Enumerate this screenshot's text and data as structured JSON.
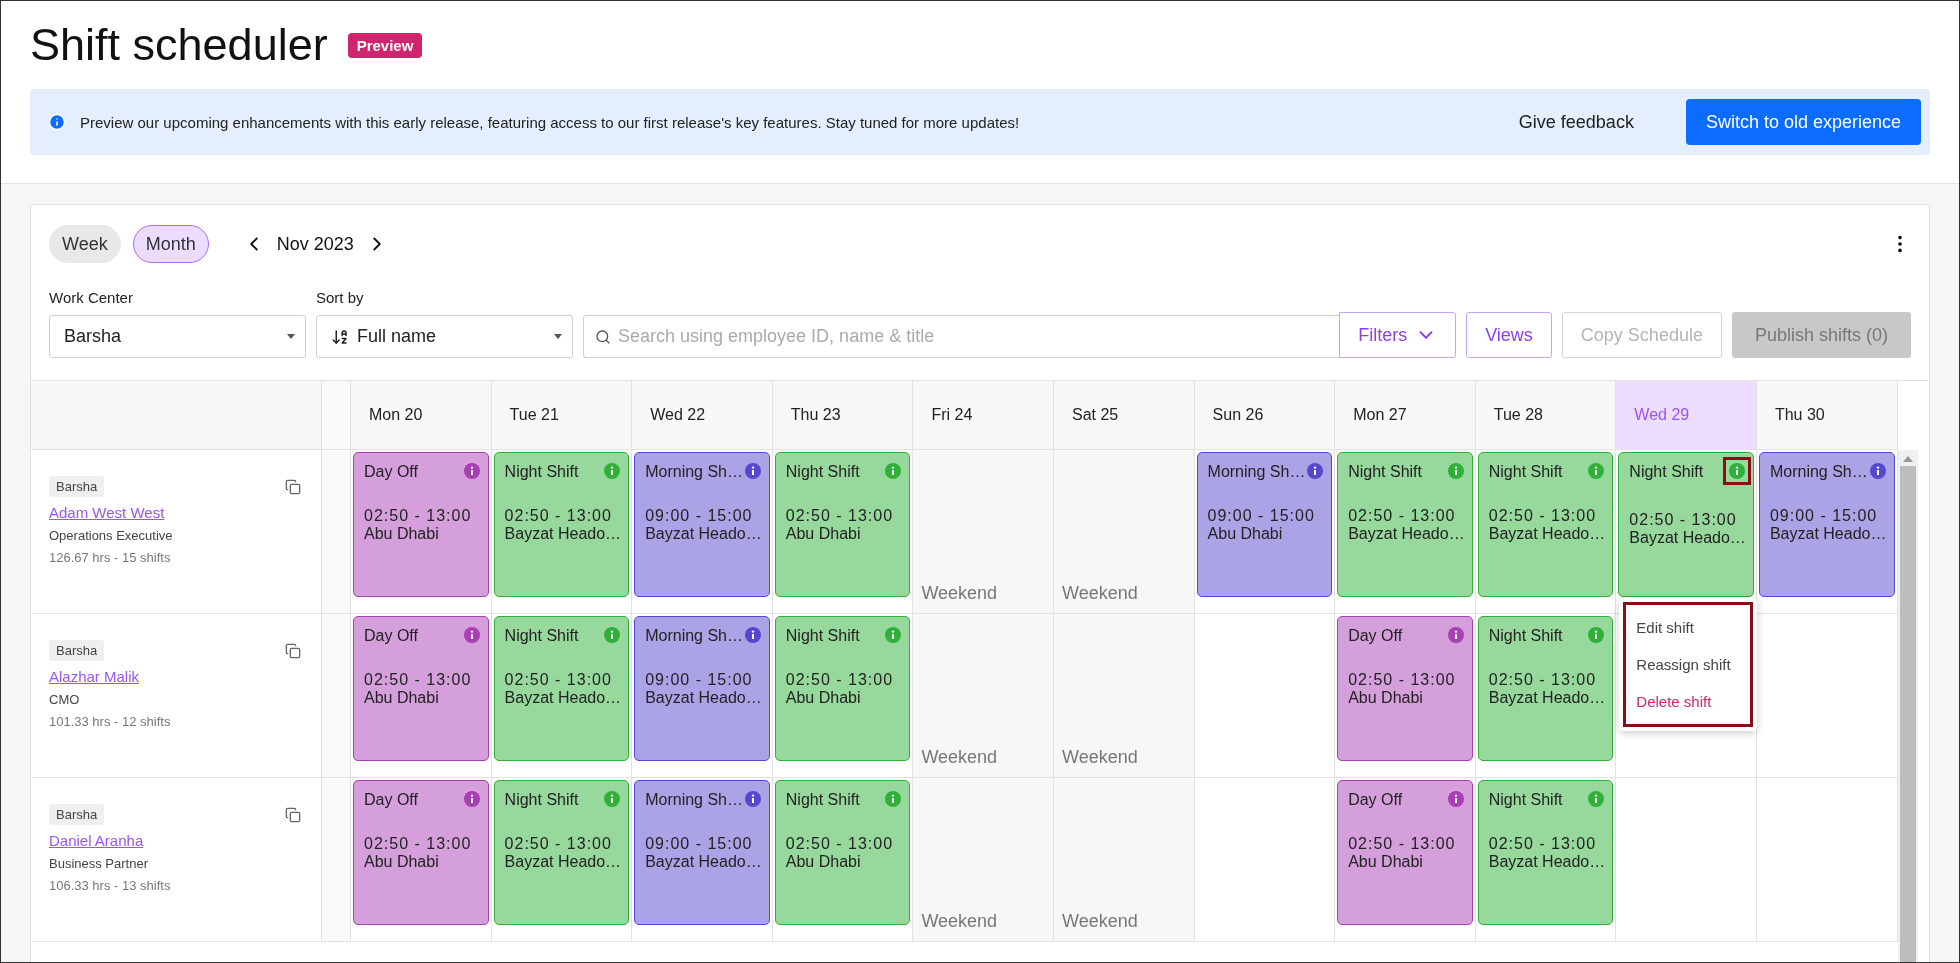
{
  "page": {
    "title": "Shift scheduler",
    "badge": "Preview"
  },
  "banner": {
    "message": "Preview our upcoming enhancements with this early release, featuring access to our first release's key features. Stay tuned for more updates!",
    "feedback_link": "Give feedback",
    "switch_button": "Switch to old experience"
  },
  "view_toggle": [
    {
      "label": "Week",
      "selected": false
    },
    {
      "label": "Month",
      "selected": true
    }
  ],
  "period": "Nov 2023",
  "filters": {
    "work_center": {
      "label": "Work Center",
      "value": "Barsha"
    },
    "sort_by": {
      "label": "Sort by",
      "value": "Full name"
    },
    "search": {
      "placeholder": "Search using employee ID, name & title"
    },
    "buttons": [
      {
        "label": "Filters",
        "kind": "dropdown",
        "disabled": false
      },
      {
        "label": "Views",
        "kind": "outline",
        "disabled": false
      },
      {
        "label": "Copy Schedule",
        "kind": "outline",
        "disabled": true
      },
      {
        "label": "Publish shifts (0)",
        "kind": "solid",
        "disabled": true
      }
    ]
  },
  "days": [
    {
      "label": "Mon 20",
      "selected": false
    },
    {
      "label": "Tue 21",
      "selected": false
    },
    {
      "label": "Wed 22",
      "selected": false
    },
    {
      "label": "Thu 23",
      "selected": false
    },
    {
      "label": "Fri 24",
      "selected": false
    },
    {
      "label": "Sat 25",
      "selected": false
    },
    {
      "label": "Sun 26",
      "selected": false
    },
    {
      "label": "Mon 27",
      "selected": false
    },
    {
      "label": "Tue 28",
      "selected": false
    },
    {
      "label": "Wed 29",
      "selected": true
    },
    {
      "label": "Thu 30",
      "selected": false
    }
  ],
  "employees": [
    {
      "work_center": "Barsha",
      "name": "Adam West West",
      "title": "Operations Executive",
      "hours": "126.67 hrs - 15 shifts",
      "cells": [
        {
          "kind": "shift",
          "color": "#a83fb5",
          "name": "Day Off",
          "time": "02:50 - 13:00",
          "location": "Abu Dhabi"
        },
        {
          "kind": "shift",
          "color": "#2fb039",
          "name": "Night Shift",
          "time": "02:50 - 13:00",
          "location": "Bayzat Heado…"
        },
        {
          "kind": "shift",
          "color": "#5548cf",
          "name": "Morning Sh…",
          "time": "09:00 - 15:00",
          "location": "Bayzat Heado…"
        },
        {
          "kind": "shift",
          "color": "#2fb039",
          "name": "Night Shift",
          "time": "02:50 - 13:00",
          "location": "Abu Dhabi"
        },
        {
          "kind": "weekend",
          "label": "Weekend"
        },
        {
          "kind": "weekend",
          "label": "Weekend"
        },
        {
          "kind": "shift",
          "color": "#5548cf",
          "name": "Morning Sh…",
          "time": "09:00 - 15:00",
          "location": "Abu Dhabi"
        },
        {
          "kind": "shift",
          "color": "#2fb039",
          "name": "Night Shift",
          "time": "02:50 - 13:00",
          "location": "Bayzat Heado…"
        },
        {
          "kind": "shift",
          "color": "#2fb039",
          "name": "Night Shift",
          "time": "02:50 - 13:00",
          "location": "Bayzat Heado…"
        },
        {
          "kind": "shift",
          "color": "#2fb039",
          "name": "Night Shift",
          "time": "02:50 - 13:00",
          "location": "Bayzat Heado…",
          "highlighted": true,
          "menu_open": true
        },
        {
          "kind": "shift",
          "color": "#5548cf",
          "name": "Morning Sh…",
          "time": "09:00 - 15:00",
          "location": "Bayzat Heado…"
        }
      ]
    },
    {
      "work_center": "Barsha",
      "name": "Alazhar Malik",
      "title": "CMO",
      "hours": "101.33 hrs - 12 shifts",
      "cells": [
        {
          "kind": "shift",
          "color": "#a83fb5",
          "name": "Day Off",
          "time": "02:50 - 13:00",
          "location": "Abu Dhabi"
        },
        {
          "kind": "shift",
          "color": "#2fb039",
          "name": "Night Shift",
          "time": "02:50 - 13:00",
          "location": "Bayzat Heado…"
        },
        {
          "kind": "shift",
          "color": "#5548cf",
          "name": "Morning Sh…",
          "time": "09:00 - 15:00",
          "location": "Bayzat Heado…"
        },
        {
          "kind": "shift",
          "color": "#2fb039",
          "name": "Night Shift",
          "time": "02:50 - 13:00",
          "location": "Abu Dhabi"
        },
        {
          "kind": "weekend",
          "label": "Weekend"
        },
        {
          "kind": "weekend",
          "label": "Weekend"
        },
        {
          "kind": "empty"
        },
        {
          "kind": "shift",
          "color": "#a83fb5",
          "name": "Day Off",
          "time": "02:50 - 13:00",
          "location": "Abu Dhabi"
        },
        {
          "kind": "shift",
          "color": "#2fb039",
          "name": "Night Shift",
          "time": "02:50 - 13:00",
          "location": "Bayzat Heado…"
        },
        {
          "kind": "empty"
        },
        {
          "kind": "empty"
        }
      ]
    },
    {
      "work_center": "Barsha",
      "name": "Daniel Aranha",
      "title": "Business Partner",
      "hours": "106.33 hrs - 13 shifts",
      "cells": [
        {
          "kind": "shift",
          "color": "#a83fb5",
          "name": "Day Off",
          "time": "02:50 - 13:00",
          "location": "Abu Dhabi"
        },
        {
          "kind": "shift",
          "color": "#2fb039",
          "name": "Night Shift",
          "time": "02:50 - 13:00",
          "location": "Bayzat Heado…"
        },
        {
          "kind": "shift",
          "color": "#5548cf",
          "name": "Morning Sh…",
          "time": "09:00 - 15:00",
          "location": "Bayzat Heado…"
        },
        {
          "kind": "shift",
          "color": "#2fb039",
          "name": "Night Shift",
          "time": "02:50 - 13:00",
          "location": "Abu Dhabi"
        },
        {
          "kind": "weekend",
          "label": "Weekend"
        },
        {
          "kind": "weekend",
          "label": "Weekend"
        },
        {
          "kind": "empty"
        },
        {
          "kind": "shift",
          "color": "#a83fb5",
          "name": "Day Off",
          "time": "02:50 - 13:00",
          "location": "Abu Dhabi"
        },
        {
          "kind": "shift",
          "color": "#2fb039",
          "name": "Night Shift",
          "time": "02:50 - 13:00",
          "location": "Bayzat Heado…"
        },
        {
          "kind": "empty"
        },
        {
          "kind": "empty"
        }
      ]
    }
  ],
  "context_menu": {
    "highlighted": true,
    "items": [
      {
        "label": "Edit shift",
        "kind": "normal"
      },
      {
        "label": "Reassign shift",
        "kind": "normal"
      },
      {
        "label": "Delete shift",
        "kind": "danger"
      }
    ]
  }
}
